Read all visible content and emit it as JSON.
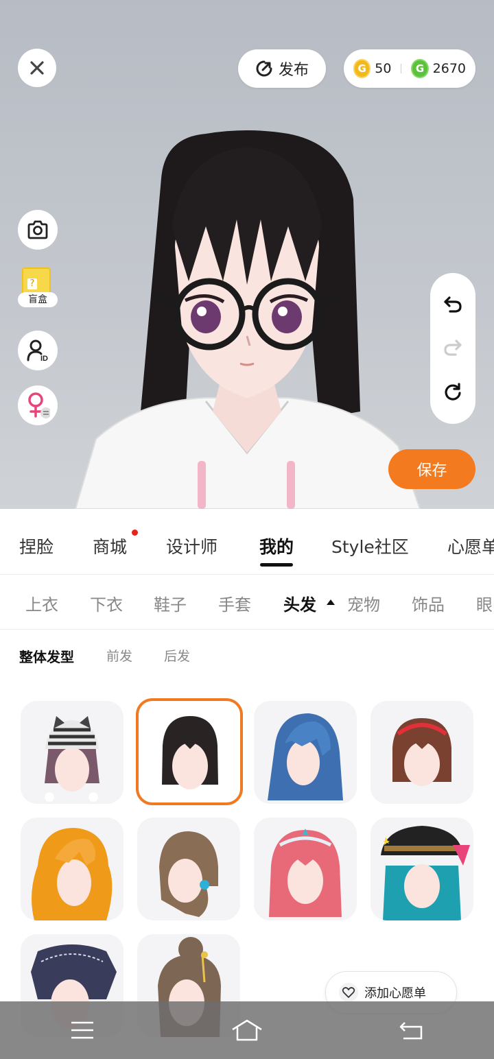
{
  "top": {
    "publish_label": "发布",
    "gold_coins": "50",
    "green_coins": "2670"
  },
  "side": {
    "blind_box_label": "盲盒",
    "blind_box_mark": "?"
  },
  "save_label": "保存",
  "tabs": [
    {
      "label": "捏脸"
    },
    {
      "label": "商城"
    },
    {
      "label": "设计师"
    },
    {
      "label": "我的"
    },
    {
      "label": "Style社区"
    },
    {
      "label": "心愿单"
    }
  ],
  "subtabs": [
    {
      "label": "上衣"
    },
    {
      "label": "下衣"
    },
    {
      "label": "鞋子"
    },
    {
      "label": "手套"
    },
    {
      "label": "头发"
    },
    {
      "label": "宠物"
    },
    {
      "label": "饰品"
    },
    {
      "label": "眼"
    }
  ],
  "filters": [
    {
      "label": "整体发型"
    },
    {
      "label": "前发"
    },
    {
      "label": "后发"
    }
  ],
  "hair_items": [
    {
      "icon": "beanie-hair-item",
      "color": "#7a5a6a"
    },
    {
      "icon": "black-bob-hair-item",
      "color": "#2a2323"
    },
    {
      "icon": "blue-long-hair-item",
      "color": "#3e6fb0"
    },
    {
      "icon": "brown-bob-headband-item",
      "color": "#7a4030"
    },
    {
      "icon": "orange-wavy-hair-item",
      "color": "#f09a1a"
    },
    {
      "icon": "brown-side-tail-item",
      "color": "#8a6d55"
    },
    {
      "icon": "pink-tiara-hair-item",
      "color": "#e86a78"
    },
    {
      "icon": "teal-cap-hair-item",
      "color": "#1ea0b0"
    },
    {
      "icon": "navy-messy-hair-item",
      "color": "#3a3c5c"
    },
    {
      "icon": "brown-updo-hair-item",
      "color": "#7e6655"
    }
  ],
  "wishlist_button": "添加心愿单",
  "colors": {
    "accent": "#f47a1f",
    "notification": "#e8221c"
  }
}
